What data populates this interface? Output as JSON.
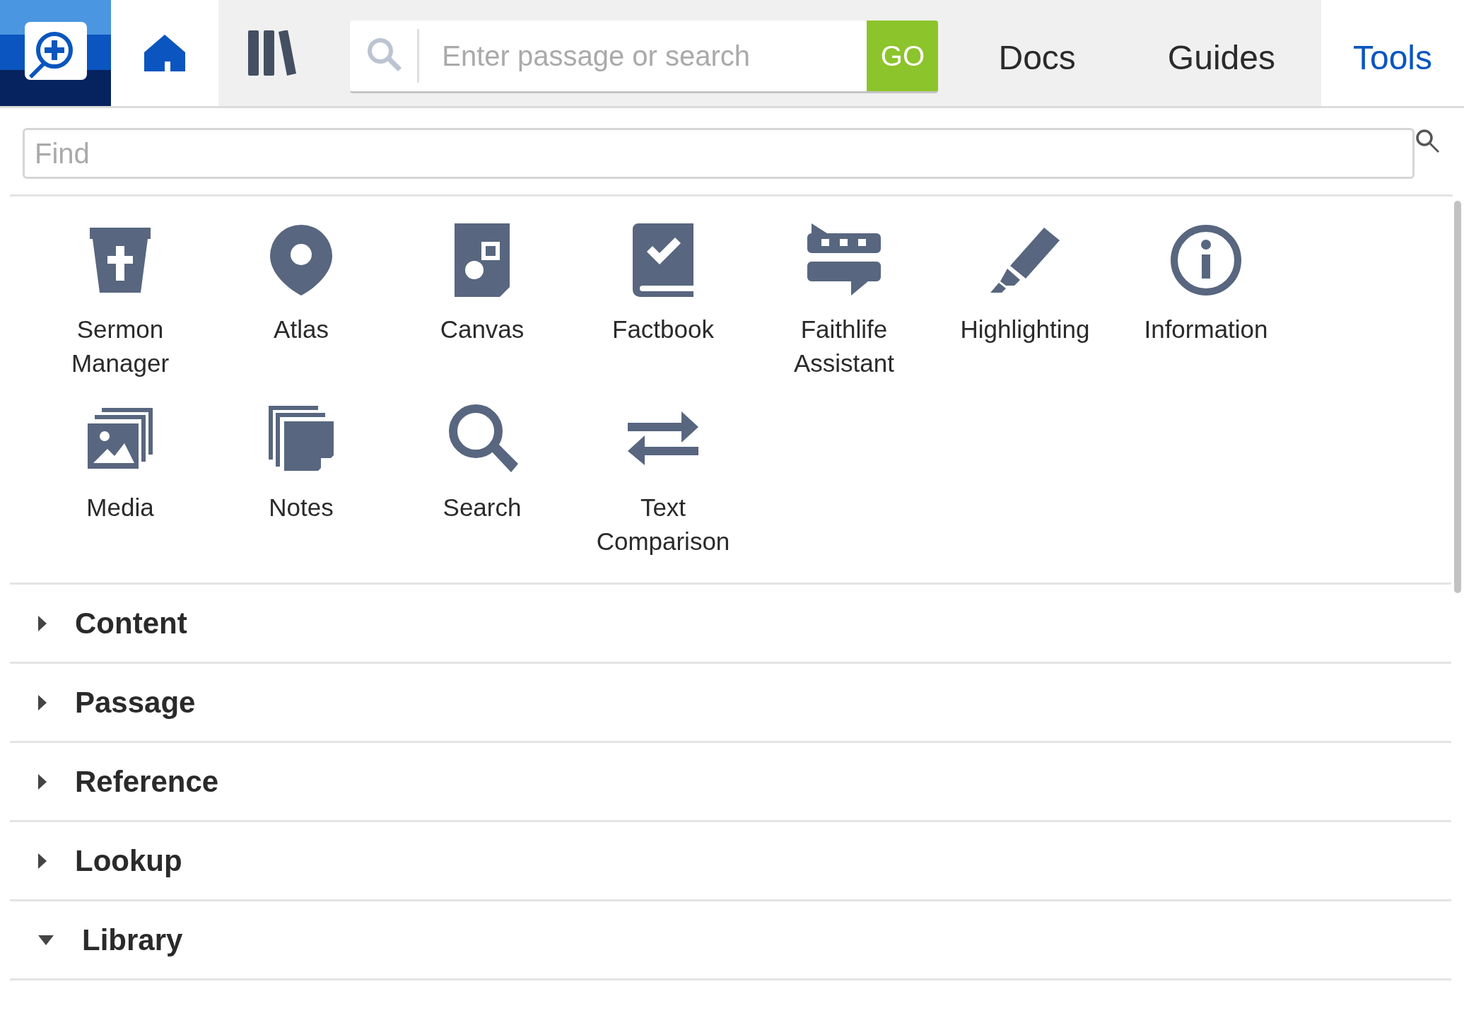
{
  "nav": {
    "icon_tabs": [
      {
        "selected": true
      },
      {
        "selected": false
      }
    ],
    "search": {
      "placeholder": "Enter passage or search",
      "button": "GO"
    },
    "tabs": [
      {
        "label": "Docs",
        "selected": false
      },
      {
        "label": "Guides",
        "selected": false
      },
      {
        "label": "Tools",
        "selected": true
      }
    ]
  },
  "find": {
    "placeholder": "Find"
  },
  "tools": [
    {
      "label": "Sermon Manager"
    },
    {
      "label": "Atlas"
    },
    {
      "label": "Canvas"
    },
    {
      "label": "Factbook"
    },
    {
      "label": "Faithlife Assistant"
    },
    {
      "label": "Highlighting"
    },
    {
      "label": "Information"
    },
    {
      "label": "Media"
    },
    {
      "label": "Notes"
    },
    {
      "label": "Search"
    },
    {
      "label": "Text Comparison"
    }
  ],
  "sections": [
    {
      "title": "Content",
      "expanded": false
    },
    {
      "title": "Passage",
      "expanded": false
    },
    {
      "title": "Reference",
      "expanded": false
    },
    {
      "title": "Lookup",
      "expanded": false
    },
    {
      "title": "Library",
      "expanded": true
    }
  ]
}
